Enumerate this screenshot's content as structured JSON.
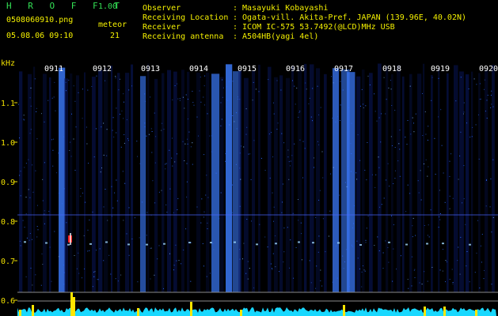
{
  "app": {
    "name": "H R O F F T",
    "version": "1.00"
  },
  "file": {
    "name": "0508060910.png",
    "datetime": "05.08.06 09:10"
  },
  "meteor": {
    "label": "meteor",
    "count": "21"
  },
  "info": [
    {
      "key": "Observer",
      "value": ": Masayuki Kobayashi"
    },
    {
      "key": "Receiving Location",
      "value": ": Ogata-vill. Akita-Pref. JAPAN (139.96E, 40.02N)"
    },
    {
      "key": "Receiver",
      "value": ": ICOM IC-575 53.7492(@LCD)MHz USB"
    },
    {
      "key": "Receiving antenna",
      "value": ": A504HB(yagi 4el)"
    }
  ],
  "chart_data": {
    "type": "heatmap",
    "y_unit": "kHz",
    "y_ticks": [
      "1.1",
      "1.0",
      "0.9",
      "0.8",
      "0.7",
      "0.6"
    ],
    "y_values": [
      1.1,
      1.0,
      0.9,
      0.8,
      0.7,
      0.6
    ],
    "x_ticks": [
      "0911",
      "0912",
      "0913",
      "0914",
      "0915",
      "0916",
      "0917",
      "0918",
      "0919",
      "0920"
    ],
    "colors": {
      "background": "#000000",
      "signal_low": "#0a1a6a",
      "signal_high": "#3c7cff",
      "trace": "#18d8ff",
      "marker": "#ffe600",
      "echo": "#ff2020"
    }
  }
}
